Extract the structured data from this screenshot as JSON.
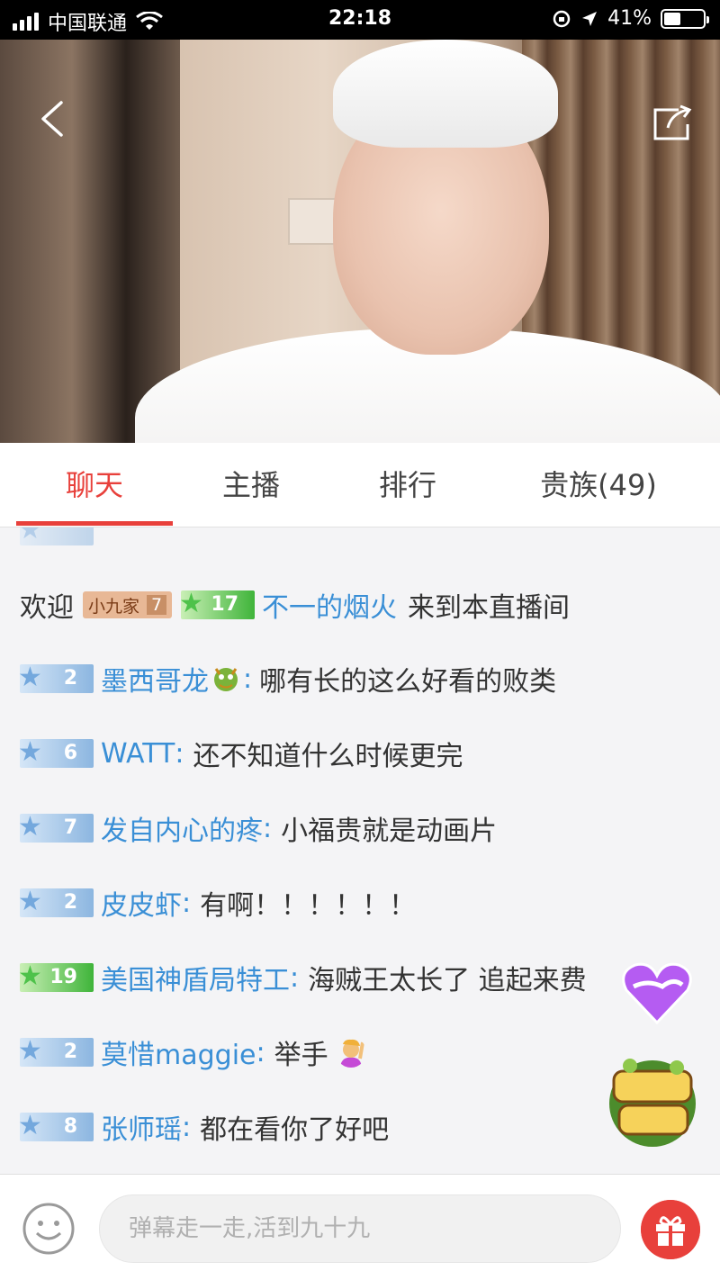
{
  "status_bar": {
    "carrier": "中国联通",
    "time": "22:18",
    "battery": "41%",
    "battery_level": 0.41
  },
  "tabs": [
    {
      "label": "聊天",
      "active": true
    },
    {
      "label": "主播",
      "active": false
    },
    {
      "label": "排行",
      "active": false
    },
    {
      "label": "贵族(49)",
      "active": false
    }
  ],
  "chat": {
    "welcome": {
      "prefix": "欢迎",
      "fan_badge": "小九家",
      "fan_level": "7",
      "user_level": "17",
      "username": "不一的烟火",
      "suffix": "来到本直播间"
    },
    "messages": [
      {
        "level": "2",
        "username": "墨西哥龙",
        "has_emoji": "dragon",
        "text": "哪有长的这么好看的败类"
      },
      {
        "level": "6",
        "username": "WATT",
        "text": "还不知道什么时候更完"
      },
      {
        "level": "7",
        "username": "发自内心的疼",
        "text": "小福贵就是动画片"
      },
      {
        "level": "2",
        "username": "皮皮虾",
        "text": "有啊！！！！！！"
      },
      {
        "level": "19",
        "username": "美国神盾局特工",
        "text": "海贼王太长了 追起来费"
      },
      {
        "level": "2",
        "username": "莫惜maggie",
        "text": "举手",
        "has_emoji": "raising-hand"
      },
      {
        "level": "8",
        "username": "张师瑶",
        "text": "都在看你了好吧"
      }
    ]
  },
  "floating": {
    "promo_icon": "gift-heart-icon",
    "game_icon": "pet-garden-icon"
  },
  "input": {
    "placeholder": "弹幕走一走,活到九十九"
  },
  "colors": {
    "accent": "#e8403b",
    "username": "#3a8fd6"
  }
}
